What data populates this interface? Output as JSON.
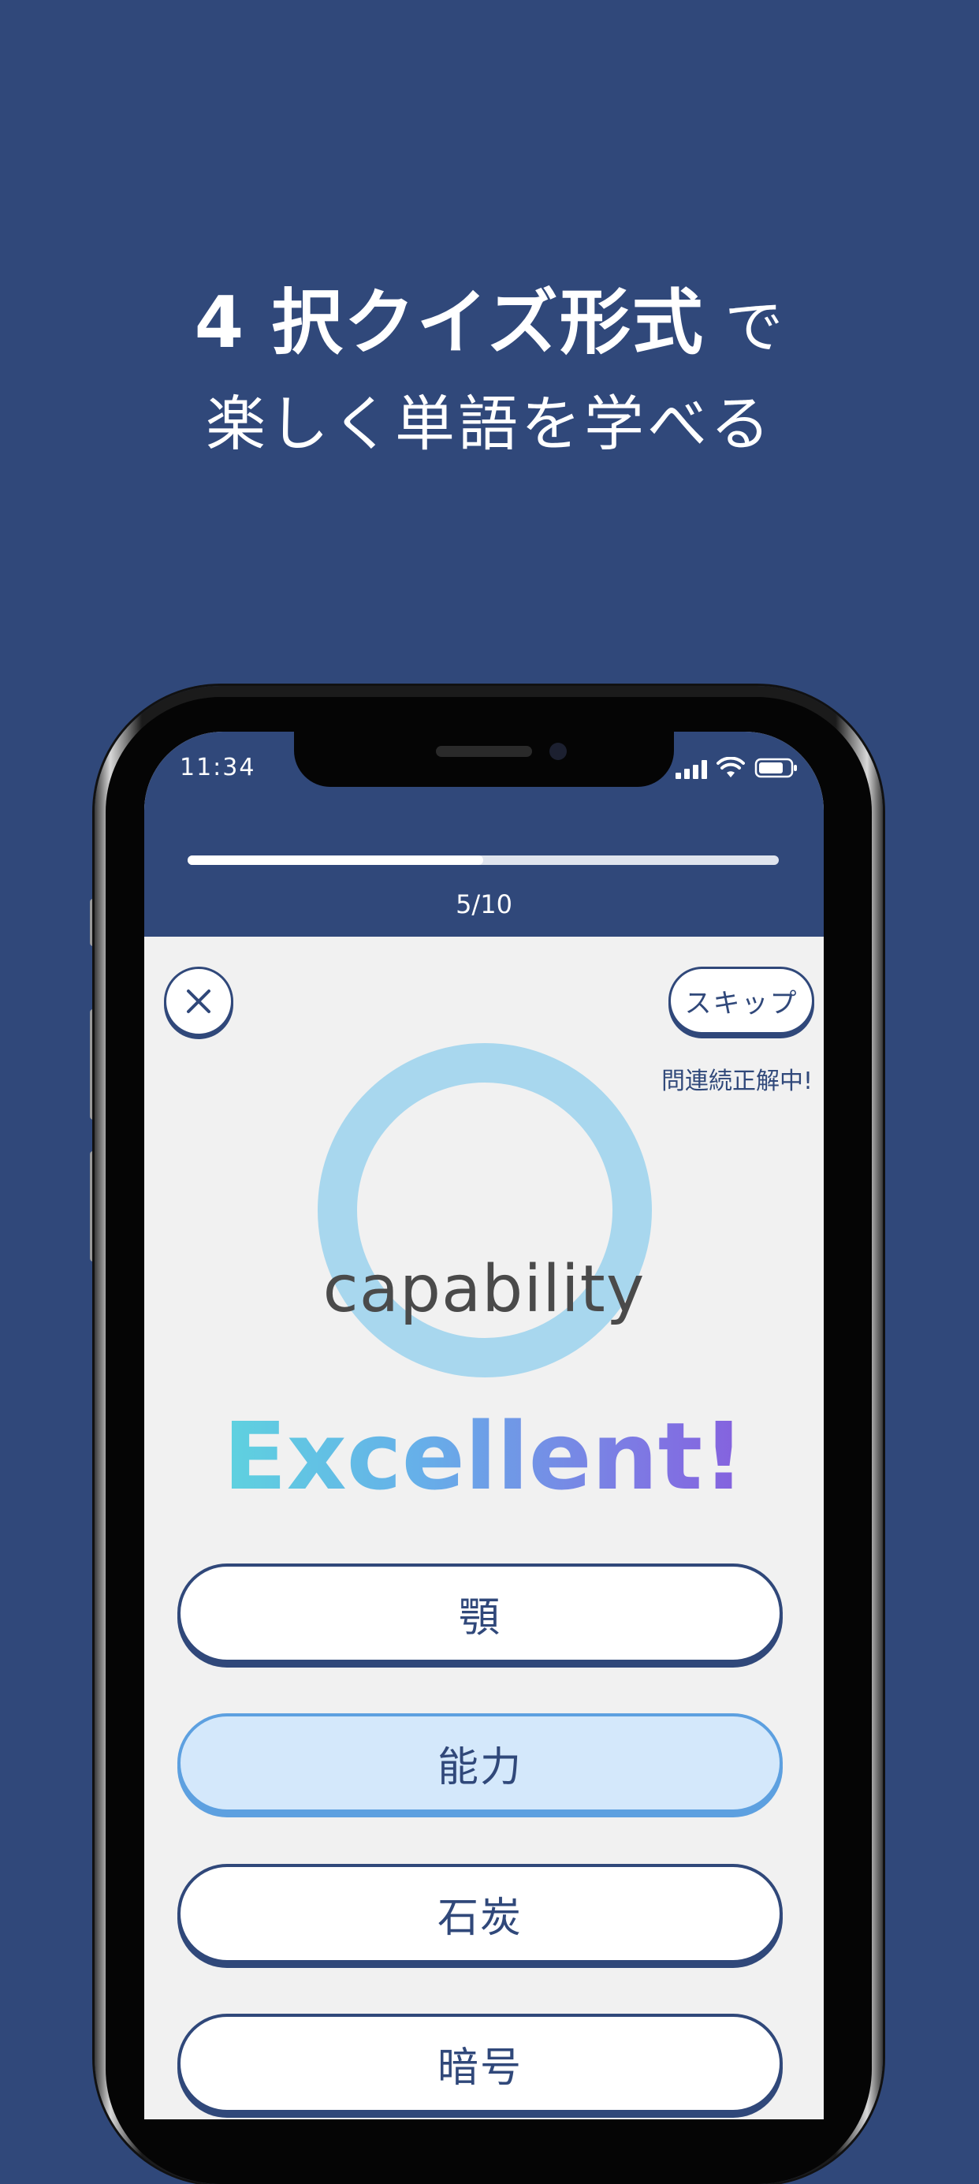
{
  "headline": {
    "line1_bold": "4 択クイズ形式",
    "line1_light": " で",
    "line2": "楽しく単語を学べる"
  },
  "status_bar": {
    "time": "11:34",
    "icons": [
      "cellular-signal-icon",
      "wifi-icon",
      "battery-icon"
    ]
  },
  "quiz": {
    "progress_text": "5/10",
    "progress_fraction": 0.5,
    "skip_label": "スキップ",
    "streak_text": "問連続正解中!",
    "word": "capability",
    "feedback": "Excellent!",
    "choices": [
      {
        "label": "顎",
        "selected": false
      },
      {
        "label": "能力",
        "selected": true
      },
      {
        "label": "石炭",
        "selected": false
      },
      {
        "label": "暗号",
        "selected": false
      }
    ]
  },
  "colors": {
    "background": "#30487a",
    "ring": "#a8d7ee",
    "selected_choice": "#d4e8fb",
    "selected_border": "#5da0e0",
    "gradient": [
      "#5be0db",
      "#66b0e9",
      "#7f75e3",
      "#8a4fd9"
    ]
  }
}
